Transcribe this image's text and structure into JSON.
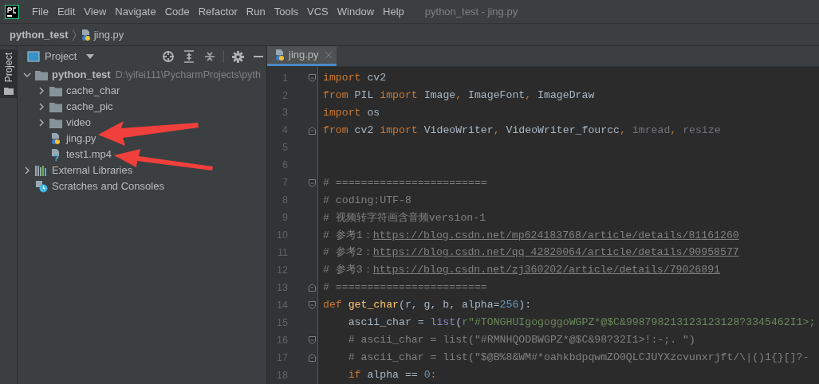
{
  "menu_bar": {
    "items": [
      "File",
      "Edit",
      "View",
      "Navigate",
      "Code",
      "Refactor",
      "Run",
      "Tools",
      "VCS",
      "Window",
      "Help"
    ],
    "title": "python_test - jing.py"
  },
  "breadcrumb": [
    "python_test",
    "jing.py"
  ],
  "side_stripe": {
    "tabs": [
      {
        "label": "Project",
        "selected": true
      }
    ]
  },
  "project_panel": {
    "title": "Project",
    "tree": [
      {
        "label": "python_test",
        "path": "D:\\yifei111\\PycharmProjects\\pyth",
        "kind": "folder",
        "expanded": true,
        "children": [
          {
            "label": "cache_char",
            "kind": "folder",
            "expanded": false
          },
          {
            "label": "cache_pic",
            "kind": "folder",
            "expanded": false
          },
          {
            "label": "video",
            "kind": "folder",
            "expanded": false
          },
          {
            "label": "jing.py",
            "kind": "python"
          },
          {
            "label": "test1.mp4",
            "kind": "unknown"
          }
        ]
      },
      {
        "label": "External Libraries",
        "kind": "library",
        "expanded": false
      },
      {
        "label": "Scratches and Consoles",
        "kind": "scratches"
      }
    ]
  },
  "editor": {
    "tabs": [
      {
        "label": "jing.py",
        "selected": true
      }
    ],
    "lines": [
      {
        "number": "1",
        "fold_start": true,
        "tokens": [
          {
            "kind": "kw",
            "t": "import "
          },
          {
            "kind": "plain",
            "t": "cv2"
          }
        ]
      },
      {
        "number": "2",
        "tokens": [
          {
            "kind": "kw",
            "t": "from "
          },
          {
            "kind": "plain",
            "t": "PIL "
          },
          {
            "kind": "kw",
            "t": "import "
          },
          {
            "kind": "plain",
            "t": "Image"
          },
          {
            "kind": "kw",
            "t": ", "
          },
          {
            "kind": "plain",
            "t": "ImageFont"
          },
          {
            "kind": "kw",
            "t": ", "
          },
          {
            "kind": "plain",
            "t": "ImageDraw"
          }
        ]
      },
      {
        "number": "3",
        "tokens": [
          {
            "kind": "kw",
            "t": "import "
          },
          {
            "kind": "plain",
            "t": "os"
          }
        ]
      },
      {
        "number": "4",
        "fold_end": true,
        "tokens": [
          {
            "kind": "kw",
            "t": "from "
          },
          {
            "kind": "plain",
            "t": "cv2 "
          },
          {
            "kind": "kw",
            "t": "import "
          },
          {
            "kind": "plain",
            "t": "VideoWriter"
          },
          {
            "kind": "kw",
            "t": ", "
          },
          {
            "kind": "plain",
            "t": "VideoWriter_fourcc"
          },
          {
            "kind": "kw",
            "t": ", "
          },
          {
            "kind": "dim",
            "t": "imread"
          },
          {
            "kind": "kw",
            "t": ", "
          },
          {
            "kind": "dim",
            "t": "resize"
          }
        ]
      },
      {
        "number": "5"
      },
      {
        "number": "6"
      },
      {
        "number": "7",
        "fold_start": true,
        "tokens": [
          {
            "kind": "comment",
            "t": "# ========================"
          }
        ]
      },
      {
        "number": "8",
        "tokens": [
          {
            "kind": "comment",
            "t": "# coding:UTF-8"
          }
        ]
      },
      {
        "number": "9",
        "tokens": [
          {
            "kind": "comment",
            "t": "# 视频转字符画含音频version-1"
          }
        ]
      },
      {
        "number": "10",
        "tokens": [
          {
            "kind": "comment",
            "t": "# 参考1："
          },
          {
            "kind": "link",
            "t": "https://blog.csdn.net/mp624183768/article/details/81161260"
          }
        ]
      },
      {
        "number": "11",
        "tokens": [
          {
            "kind": "comment",
            "t": "# 参考2："
          },
          {
            "kind": "link",
            "t": "https://blog.csdn.net/qq_42820064/article/details/90958577"
          }
        ]
      },
      {
        "number": "12",
        "tokens": [
          {
            "kind": "comment",
            "t": "# 参考3："
          },
          {
            "kind": "link",
            "t": "https://blog.csdn.net/zj360202/article/details/79026891"
          }
        ]
      },
      {
        "number": "13",
        "fold_end": true,
        "tokens": [
          {
            "kind": "comment",
            "t": "# ========================"
          }
        ]
      },
      {
        "number": "14",
        "fold_start": true,
        "tokens": [
          {
            "kind": "kw",
            "t": "def "
          },
          {
            "kind": "func",
            "t": "get_char"
          },
          {
            "kind": "plain",
            "t": "(r, g, b, alpha="
          },
          {
            "kind": "num",
            "t": "256"
          },
          {
            "kind": "plain",
            "t": "):"
          }
        ]
      },
      {
        "number": "15",
        "tokens": [
          {
            "kind": "plain",
            "t": "    ascii_char = "
          },
          {
            "kind": "builtin",
            "t": "list"
          },
          {
            "kind": "plain",
            "t": "("
          },
          {
            "kind": "str",
            "t": "r\"#TONGHUIgogoggoWGPZ*@$C&998798213123123128?3345462I1>;"
          }
        ]
      },
      {
        "number": "16",
        "fold_start": true,
        "tokens": [
          {
            "kind": "comment",
            "t": "    # ascii_char = list(\"#RMNHQODBWGPZ*@$C&98?32I1>!:-;. \")"
          }
        ]
      },
      {
        "number": "17",
        "fold_end": true,
        "tokens": [
          {
            "kind": "comment",
            "t": "    # ascii_char = list(\"$@B%8&WM#*oahkbdpqwmZO0QLCJUYXzcvunxrjft/\\|()1{}[]?-"
          }
        ]
      },
      {
        "number": "18",
        "tokens": [
          {
            "kind": "kw",
            "t": "    if "
          },
          {
            "kind": "plain",
            "t": "alpha == "
          },
          {
            "kind": "num",
            "t": "0"
          },
          {
            "kind": "kw",
            "t": ":"
          }
        ]
      }
    ]
  }
}
